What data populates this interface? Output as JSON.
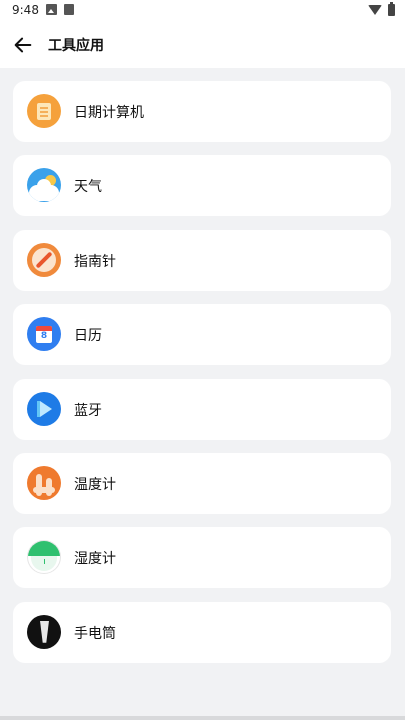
{
  "status": {
    "time": "9:48"
  },
  "header": {
    "title": "工具应用",
    "back_icon": "arrow-left-icon"
  },
  "items": [
    {
      "label": "日期计算机",
      "icon": "calendar-calculator-icon",
      "color": "#f5a13c"
    },
    {
      "label": "天气",
      "icon": "weather-icon",
      "color": "#3aa1ea"
    },
    {
      "label": "指南针",
      "icon": "compass-icon",
      "color": "#f08a3c"
    },
    {
      "label": "日历",
      "icon": "calendar-icon",
      "color": "#2f7ef0",
      "icon_text": "8"
    },
    {
      "label": "蓝牙",
      "icon": "bluetooth-icon",
      "color": "#1e7be6"
    },
    {
      "label": "温度计",
      "icon": "thermometer-icon",
      "color": "#ef7a2e"
    },
    {
      "label": "湿度计",
      "icon": "hygrometer-icon",
      "color": "#2fc06f"
    },
    {
      "label": "手电筒",
      "icon": "flashlight-icon",
      "color": "#111111"
    }
  ]
}
